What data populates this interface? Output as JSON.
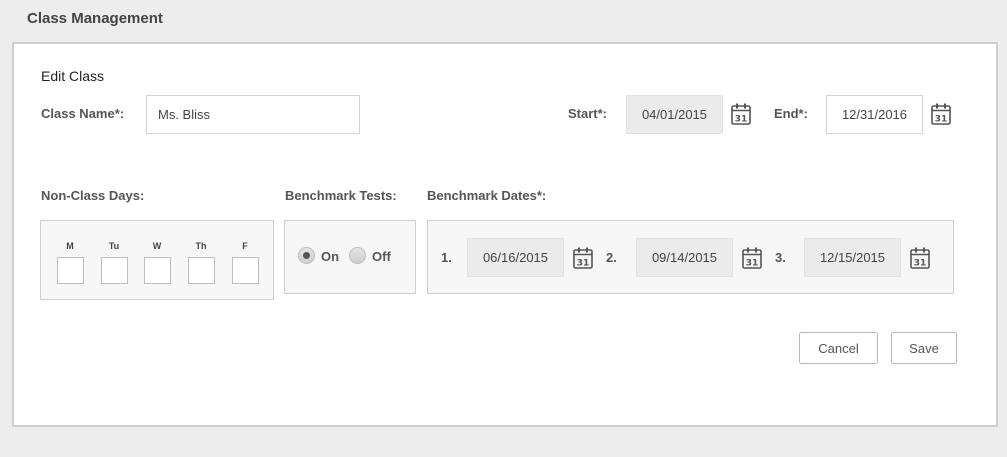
{
  "page": {
    "title": "Class Management"
  },
  "form": {
    "title": "Edit Class",
    "class_name_label": "Class Name*:",
    "class_name_value": "Ms. Bliss",
    "start_label": "Start*:",
    "start_value": "04/01/2015",
    "end_label": "End*:",
    "end_value": "12/31/2016",
    "non_class_days_label": "Non-Class Days:",
    "days": [
      "M",
      "Tu",
      "W",
      "Th",
      "F"
    ],
    "benchmark_tests_label": "Benchmark Tests:",
    "benchmark_on_label": "On",
    "benchmark_off_label": "Off",
    "benchmark_selected": "On",
    "benchmark_dates_label": "Benchmark Dates*:",
    "benchmark_dates": [
      {
        "num": "1.",
        "value": "06/16/2015"
      },
      {
        "num": "2.",
        "value": "09/14/2015"
      },
      {
        "num": "3.",
        "value": "12/15/2015"
      }
    ],
    "cancel_label": "Cancel",
    "save_label": "Save"
  },
  "icons": {
    "calendar": "calendar-icon",
    "calendar_day": "31"
  }
}
